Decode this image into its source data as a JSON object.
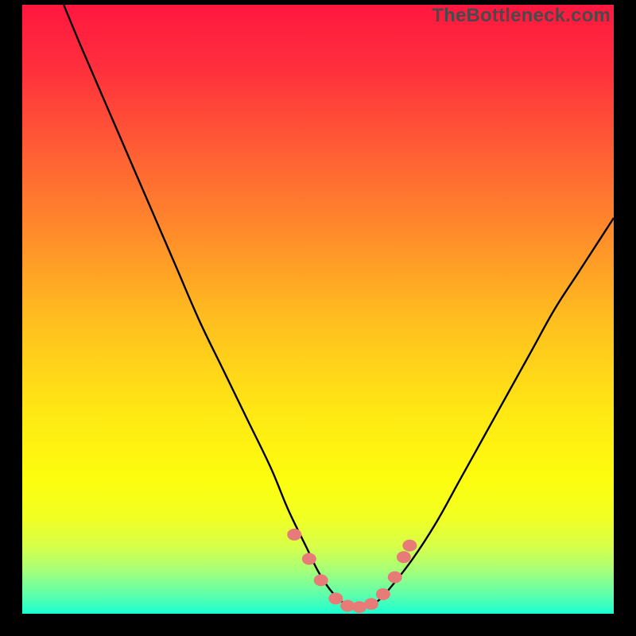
{
  "watermark": "TheBottleneck.com",
  "chart_data": {
    "type": "line",
    "title": "",
    "xlabel": "",
    "ylabel": "",
    "xlim": [
      0,
      100
    ],
    "ylim": [
      0,
      100
    ],
    "series": [
      {
        "name": "bottleneck-curve",
        "x": [
          7,
          10,
          14,
          18,
          22,
          26,
          30,
          34,
          38,
          42,
          45,
          48,
          50,
          52,
          54,
          56,
          58,
          60,
          62,
          66,
          70,
          74,
          78,
          82,
          86,
          90,
          94,
          98,
          100
        ],
        "y": [
          100,
          93,
          84,
          75,
          66,
          57,
          48,
          40,
          32,
          24,
          17,
          11,
          7,
          4,
          2,
          1,
          1,
          2,
          4,
          9,
          15,
          22,
          29,
          36,
          43,
          50,
          56,
          62,
          65
        ]
      }
    ],
    "markers": {
      "name": "highlight-dots",
      "color": "#e77b78",
      "points": [
        {
          "x": 46,
          "y": 13
        },
        {
          "x": 48.5,
          "y": 9
        },
        {
          "x": 50.5,
          "y": 5.5
        },
        {
          "x": 53,
          "y": 2.5
        },
        {
          "x": 55,
          "y": 1.3
        },
        {
          "x": 57,
          "y": 1.1
        },
        {
          "x": 59,
          "y": 1.6
        },
        {
          "x": 61,
          "y": 3.2
        },
        {
          "x": 63,
          "y": 6.0
        },
        {
          "x": 64.5,
          "y": 9.3
        },
        {
          "x": 65.5,
          "y": 11.2
        }
      ]
    },
    "background_gradient": {
      "top": "#ff173f",
      "mid": "#ffe814",
      "bottom": "#1affd1"
    }
  }
}
